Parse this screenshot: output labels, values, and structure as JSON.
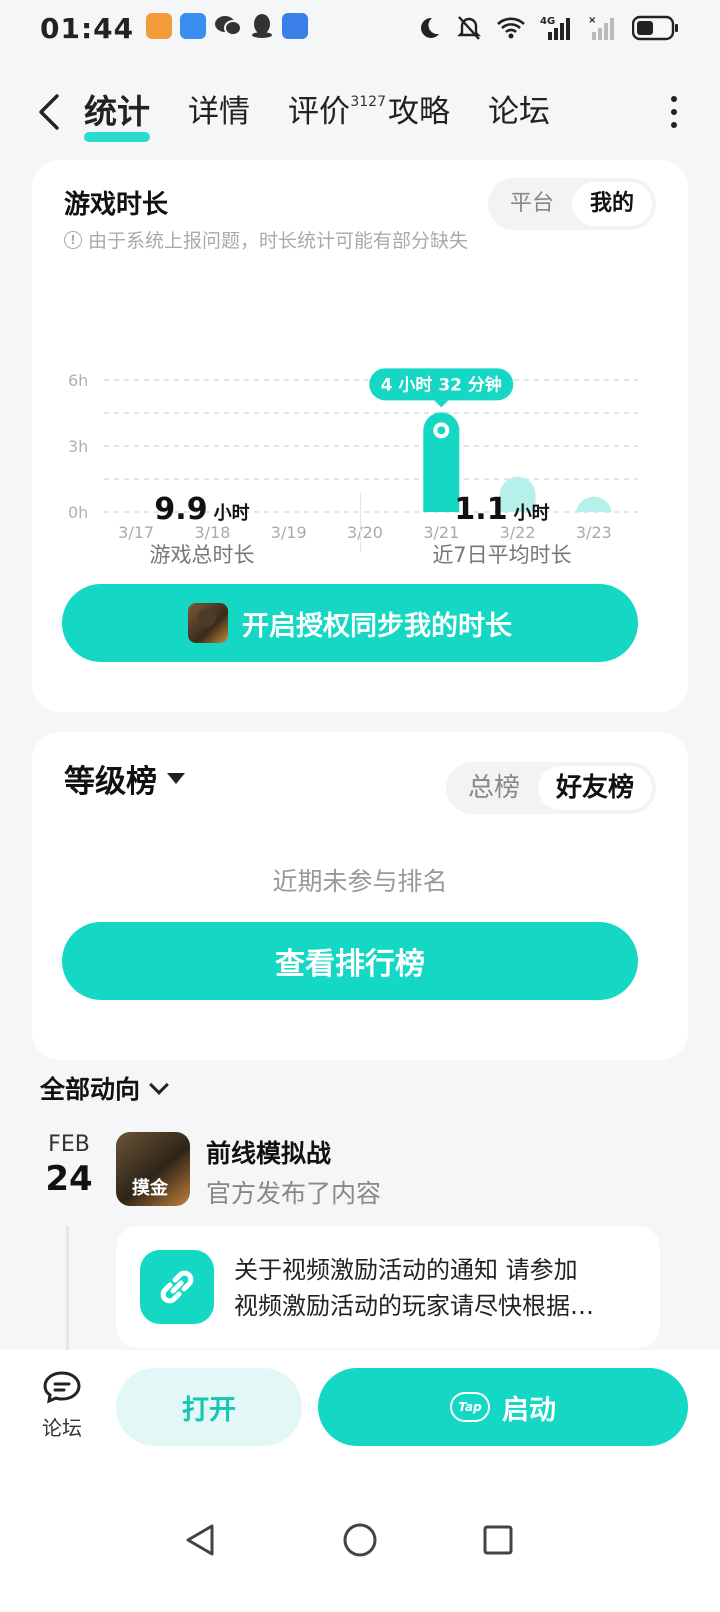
{
  "status_bar": {
    "time": "01:44",
    "app_icons": [
      {
        "name": "heart-app-icon",
        "color": "#f39a3a"
      },
      {
        "name": "bag-app-icon",
        "color": "#3a8ef0"
      },
      {
        "name": "wechat-icon",
        "color": "#333333"
      },
      {
        "name": "qq-icon",
        "color": "#333333"
      },
      {
        "name": "shield-app-icon",
        "color": "#3a7ee8"
      }
    ],
    "network": "4G"
  },
  "tabs": [
    {
      "label": "统计",
      "active": true
    },
    {
      "label": "详情",
      "active": false
    },
    {
      "label": "评价",
      "active": false,
      "badge": "3127"
    },
    {
      "label": "攻略",
      "active": false
    },
    {
      "label": "论坛",
      "active": false
    }
  ],
  "playtime": {
    "title": "游戏时长",
    "notice": "由于系统上报问题，时长统计可能有部分缺失",
    "toggle": {
      "options": [
        "平台",
        "我的"
      ],
      "selected": "我的"
    },
    "total_value": "9.9",
    "total_unit": "小时",
    "total_label": "游戏总时长",
    "avg_value": "1.1",
    "avg_unit": "小时",
    "avg_label": "近7日平均时长",
    "sync_button": "开启授权同步我的时长"
  },
  "chart_data": {
    "type": "bar",
    "categories": [
      "3/17",
      "3/18",
      "3/19",
      "3/20",
      "3/21",
      "3/22",
      "3/23"
    ],
    "values": [
      0,
      0,
      0,
      0,
      4.53,
      1.6,
      0.7
    ],
    "unit": "h",
    "yticks": [
      "0h",
      "3h",
      "6h"
    ],
    "ylim": [
      0,
      6
    ],
    "grid": true,
    "highlight_index": 4,
    "tooltip": "4 小时 32 分钟",
    "colors": {
      "highlight": "#14d7c4",
      "normal": "#b6f0ea",
      "grid": "#dcdcdc"
    }
  },
  "ranking": {
    "title": "等级榜",
    "toggle": {
      "options": [
        "总榜",
        "好友榜"
      ],
      "selected": "好友榜"
    },
    "empty_text": "近期未参与排名",
    "button": "查看排行榜"
  },
  "activity": {
    "header": "全部动向",
    "date_month": "FEB",
    "date_day": "24",
    "game_name": "前线模拟战",
    "thumb_badge": "摸金",
    "subtitle": "官方发布了内容",
    "post_line1": "关于视频激励活动的通知 请参加",
    "post_line2": "视频激励活动的玩家请尽快根据…"
  },
  "bottom_bar": {
    "forum_label": "论坛",
    "open_button": "打开",
    "launch_button": "启动",
    "tap_logo": "Tap"
  },
  "colors": {
    "accent": "#14d7c4",
    "accent_light": "#e3f8f6"
  }
}
